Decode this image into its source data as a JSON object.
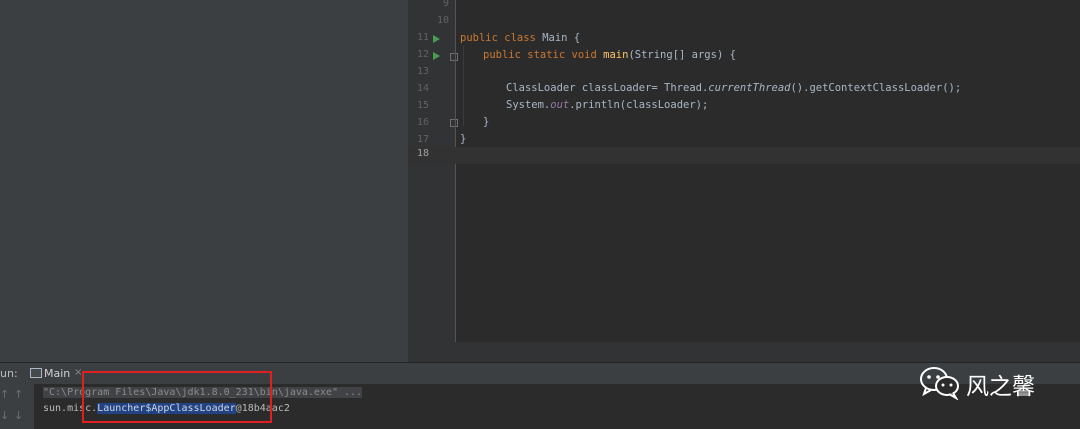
{
  "editor": {
    "lines": [
      {
        "num": "9",
        "code": ""
      },
      {
        "num": "10",
        "code": ""
      },
      {
        "num": "11",
        "kw1": "public",
        "kw2": "class",
        "name": "Main",
        "rest": " {"
      },
      {
        "num": "12",
        "kw1": "public",
        "kw2": "static",
        "kw3": "void",
        "method": "main",
        "rest": "(String[] args) {"
      },
      {
        "num": "13",
        "code": ""
      },
      {
        "num": "14",
        "pre": "ClassLoader classLoader= Thread.",
        "italic": "currentThread",
        "post": "().getContextClassLoader();"
      },
      {
        "num": "15",
        "pre": "System.",
        "field": "out",
        "post": ".println(classLoader);"
      },
      {
        "num": "16",
        "code": "}"
      },
      {
        "num": "17",
        "code": "}"
      },
      {
        "num": "18",
        "code": ""
      }
    ]
  },
  "run": {
    "label": "un:",
    "tab_label": "Main",
    "close": "×",
    "up_arrow": "↑",
    "down_arrow": "↓"
  },
  "console": {
    "command": "\"C:\\Program Files\\Java\\jdk1.8.0_231\\bin\\java.exe\" ...",
    "output_prefix": "sun.misc.",
    "output_selected": "Launcher$AppClassLoader",
    "output_suffix": "@18b4aac2"
  },
  "watermark": {
    "text": "风之馨",
    "icon": "wechat-icon"
  },
  "colors": {
    "keyword": "#cc7832",
    "method": "#ffc66d",
    "field": "#9876aa",
    "run_icon": "#499c54",
    "highlight_box": "#e02020",
    "selection": "#214283"
  }
}
